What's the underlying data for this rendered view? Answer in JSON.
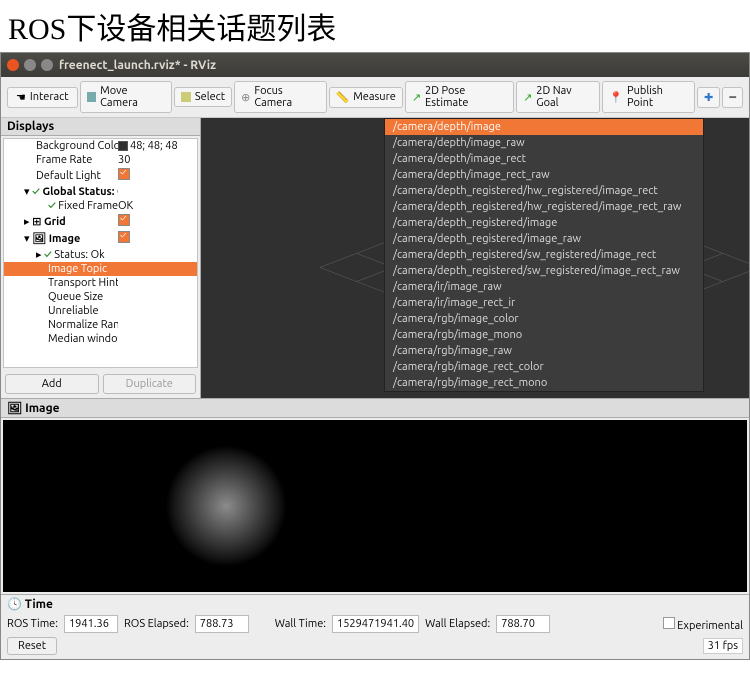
{
  "annotation": "ROS下设备相关话题列表",
  "window": {
    "title": "freenect_launch.rviz* - RViz"
  },
  "toolbar": {
    "interact": "Interact",
    "move_camera": "Move Camera",
    "select": "Select",
    "focus_camera": "Focus Camera",
    "measure": "Measure",
    "pose_estimate": "2D Pose Estimate",
    "nav_goal": "2D Nav Goal",
    "publish_point": "Publish Point"
  },
  "displays": {
    "title": "Displays",
    "bg_color_label": "Background Color",
    "bg_color_value": "48; 48; 48",
    "frame_rate_label": "Frame Rate",
    "frame_rate_value": "30",
    "default_light_label": "Default Light",
    "global_status_label": "Global Status: Ok",
    "fixed_frame_label": "Fixed Frame",
    "fixed_frame_value": "OK",
    "grid_label": "Grid",
    "image_label": "Image",
    "status_ok_label": "Status: Ok",
    "image_topic_label": "Image Topic",
    "transport_hint_label": "Transport Hint",
    "queue_size_label": "Queue Size",
    "unreliable_label": "Unreliable",
    "normalize_range_label": "Normalize Range",
    "median_window_label": "Median window",
    "add_label": "Add",
    "duplicate_label": "Duplicate"
  },
  "image_panel": {
    "title": "Image"
  },
  "topics": [
    "/camera/depth/image",
    "/camera/depth/image_raw",
    "/camera/depth/image_rect",
    "/camera/depth/image_rect_raw",
    "/camera/depth_registered/hw_registered/image_rect",
    "/camera/depth_registered/hw_registered/image_rect_raw",
    "/camera/depth_registered/image",
    "/camera/depth_registered/image_raw",
    "/camera/depth_registered/sw_registered/image_rect",
    "/camera/depth_registered/sw_registered/image_rect_raw",
    "/camera/ir/image_raw",
    "/camera/ir/image_rect_ir",
    "/camera/rgb/image_color",
    "/camera/rgb/image_mono",
    "/camera/rgb/image_raw",
    "/camera/rgb/image_rect_color",
    "/camera/rgb/image_rect_mono"
  ],
  "time": {
    "title": "Time",
    "ros_time_label": "ROS Time:",
    "ros_time_value": "1941.36",
    "ros_elapsed_label": "ROS Elapsed:",
    "ros_elapsed_value": "788.73",
    "wall_time_label": "Wall Time:",
    "wall_time_value": "1529471941.40",
    "wall_elapsed_label": "Wall Elapsed:",
    "wall_elapsed_value": "788.70",
    "experimental_label": "Experimental",
    "reset_label": "Reset",
    "fps": "31 fps"
  }
}
